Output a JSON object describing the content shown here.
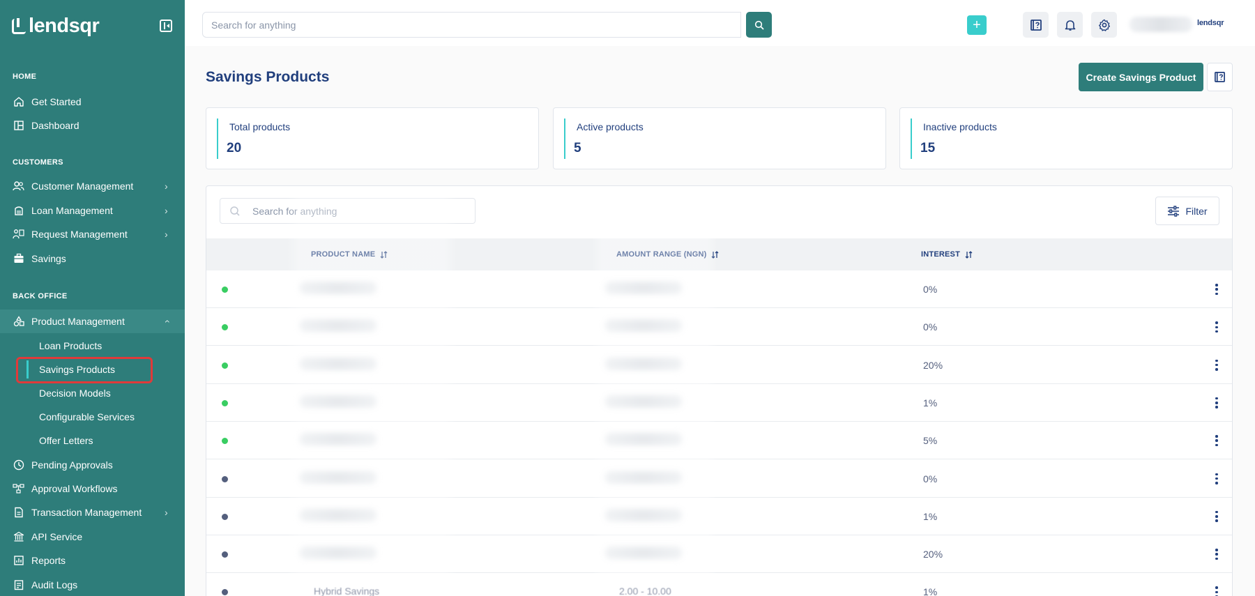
{
  "sidebar": {
    "logo_text": "lendsqr",
    "sections": {
      "home": "HOME",
      "customers": "CUSTOMERS",
      "back_office": "BACK OFFICE"
    },
    "items": {
      "get_started": "Get Started",
      "dashboard": "Dashboard",
      "customer_management": "Customer Management",
      "loan_management": "Loan Management",
      "request_management": "Request Management",
      "savings": "Savings",
      "product_management": "Product Management",
      "loan_products": "Loan Products",
      "savings_products": "Savings Products",
      "decision_models": "Decision Models",
      "configurable_services": "Configurable Services",
      "offer_letters": "Offer Letters",
      "pending_approvals": "Pending Approvals",
      "approval_workflows": "Approval Workflows",
      "transaction_management": "Transaction Management",
      "api_service": "API Service",
      "reports": "Reports",
      "audit_logs": "Audit Logs"
    }
  },
  "topbar": {
    "search_placeholder": "Search for anything",
    "plus_label": "+",
    "brand_mini": "lendsqr"
  },
  "page": {
    "title": "Savings Products",
    "create_button": "Create Savings Product"
  },
  "stats": [
    {
      "label": "Total products",
      "value": "20"
    },
    {
      "label": "Active products",
      "value": "5"
    },
    {
      "label": "Inactive products",
      "value": "15"
    }
  ],
  "table": {
    "search_placeholder": "Search for anything",
    "filter_label": "Filter",
    "columns": {
      "name": "PRODUCT NAME",
      "range": "AMOUNT RANGE (NGN)",
      "interest": "INTEREST"
    },
    "rows": [
      {
        "status": "active",
        "interest": "0%"
      },
      {
        "status": "active",
        "interest": "0%"
      },
      {
        "status": "active",
        "interest": "20%"
      },
      {
        "status": "active",
        "interest": "1%"
      },
      {
        "status": "active",
        "interest": "5%"
      },
      {
        "status": "inactive",
        "interest": "0%"
      },
      {
        "status": "inactive",
        "interest": "1%"
      },
      {
        "status": "inactive",
        "interest": "20%"
      },
      {
        "status": "inactive",
        "interest": "1%",
        "name": "Hybrid Savings",
        "range": "2.00 - 10.00"
      }
    ]
  },
  "colors": {
    "sidebar": "#2e7d7a",
    "accent": "#39cdcc",
    "active_dot": "#39cd62",
    "inactive_dot": "#545f7d",
    "highlight": "#e03a3a"
  }
}
